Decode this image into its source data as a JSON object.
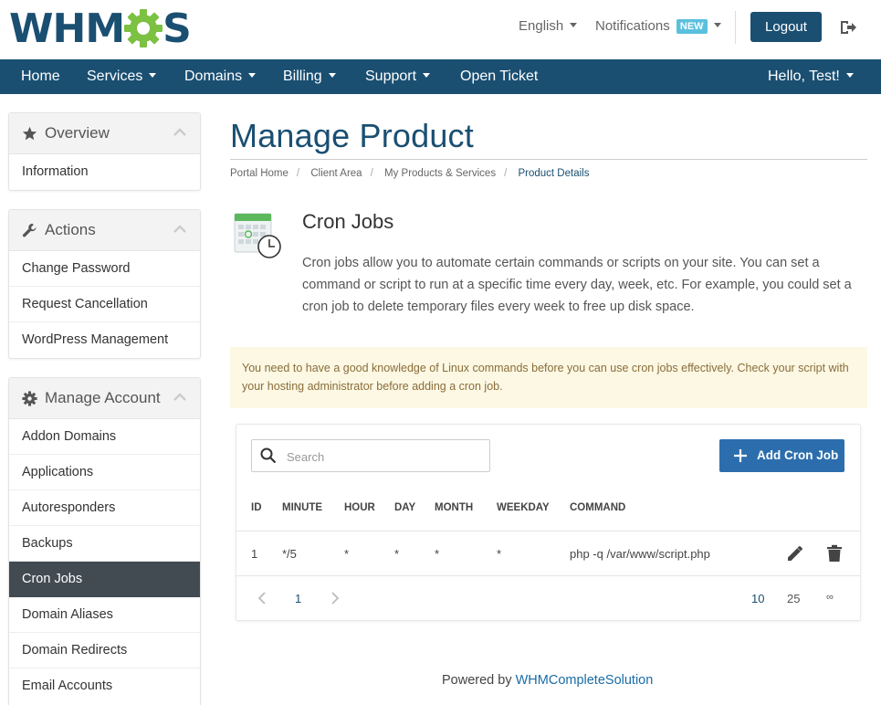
{
  "header": {
    "logo_text_left": "WHM",
    "logo_text_right": "S",
    "language": "English",
    "notifications": "Notifications",
    "notifications_badge": "NEW",
    "logout": "Logout"
  },
  "nav": {
    "items": [
      {
        "label": "Home",
        "dropdown": false
      },
      {
        "label": "Services",
        "dropdown": true
      },
      {
        "label": "Domains",
        "dropdown": true
      },
      {
        "label": "Billing",
        "dropdown": true
      },
      {
        "label": "Support",
        "dropdown": true
      },
      {
        "label": "Open Ticket",
        "dropdown": false
      }
    ],
    "user": "Hello, Test!"
  },
  "sidebar": {
    "panels": [
      {
        "title": "Overview",
        "icon": "star-icon",
        "items": [
          {
            "label": "Information"
          }
        ]
      },
      {
        "title": "Actions",
        "icon": "wrench-icon",
        "items": [
          {
            "label": "Change Password"
          },
          {
            "label": "Request Cancellation"
          },
          {
            "label": "WordPress Management"
          }
        ]
      },
      {
        "title": "Manage Account",
        "icon": "gear-icon",
        "items": [
          {
            "label": "Addon Domains"
          },
          {
            "label": "Applications"
          },
          {
            "label": "Autoresponders"
          },
          {
            "label": "Backups"
          },
          {
            "label": "Cron Jobs",
            "active": true
          },
          {
            "label": "Domain Aliases"
          },
          {
            "label": "Domain Redirects"
          },
          {
            "label": "Email Accounts"
          }
        ]
      }
    ]
  },
  "main": {
    "title": "Manage Product",
    "breadcrumb": [
      "Portal Home",
      "Client Area",
      "My Products & Services",
      "Product Details"
    ],
    "section_title": "Cron Jobs",
    "section_description": "Cron jobs allow you to automate certain commands or scripts on your site. You can set a command or script to run at a specific time every day, week, etc. For example, you could set a cron job to delete temporary files every week to free up disk space.",
    "alert": "You need to have a good knowledge of Linux commands before you can use cron jobs effectively. Check your script with your hosting administrator before adding a cron job.",
    "search_placeholder": "Search",
    "add_button": "Add Cron Job",
    "table": {
      "columns": [
        "ID",
        "MINUTE",
        "HOUR",
        "DAY",
        "MONTH",
        "WEEKDAY",
        "COMMAND"
      ],
      "rows": [
        {
          "id": "1",
          "minute": "*/5",
          "hour": "*",
          "day": "*",
          "month": "*",
          "weekday": "*",
          "command": "php -q /var/www/script.php"
        }
      ]
    },
    "pagination": {
      "current_page": "1",
      "page_sizes": [
        "10",
        "25",
        "∞"
      ],
      "active_size": "10"
    }
  },
  "footer": {
    "prefix": "Powered by",
    "link": "WHMCompleteSolution"
  },
  "colors": {
    "brand": "#1a4f72",
    "accent_green": "#7cc142",
    "button_blue": "#2c6ead",
    "alert_bg": "#fcf8e3",
    "alert_text": "#8a6d3b",
    "badge": "#5bc0de",
    "active_item": "#424a52"
  }
}
